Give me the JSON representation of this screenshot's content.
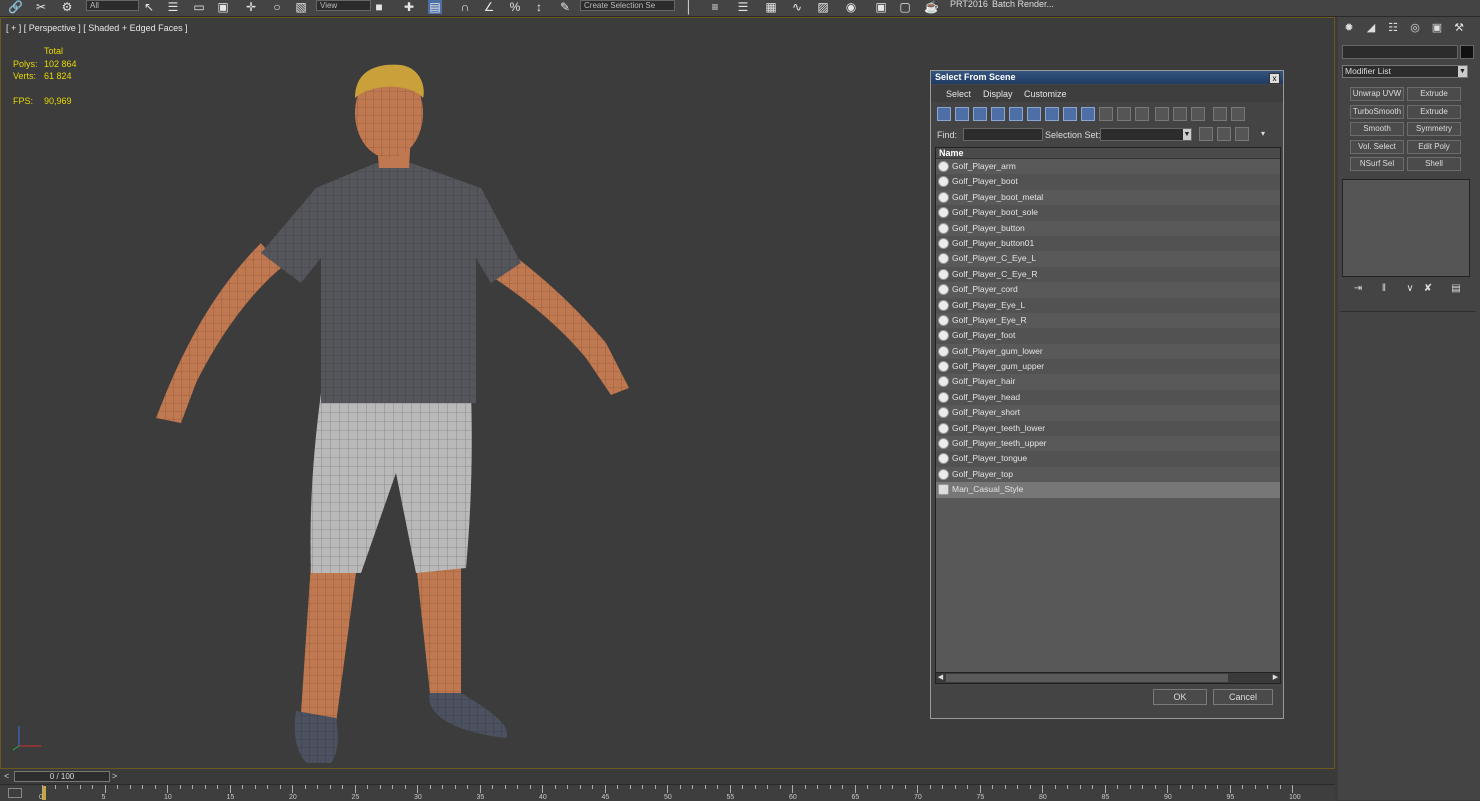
{
  "toolbar": {
    "layer_dropdown": "All",
    "ref_coord": "View",
    "selection_set_placeholder": "Create Selection Se",
    "prt_label": "PRT2016",
    "batch_render_label": "Batch Render..."
  },
  "viewport": {
    "label": "[ + ] [ Perspective ] [ Shaded + Edged Faces ]",
    "stats": {
      "total_label": "Total",
      "polys_label": "Polys:",
      "polys_value": "102 864",
      "verts_label": "Verts:",
      "verts_value": "61 824",
      "fps_label": "FPS:",
      "fps_value": "90,969"
    }
  },
  "dialog": {
    "title": "Select From Scene",
    "close": "x",
    "menu": [
      "Select",
      "Display",
      "Customize"
    ],
    "find_label": "Find:",
    "find_value": "",
    "selection_set_label": "Selection Set:",
    "list_header": "Name",
    "items": [
      "Golf_Player_arm",
      "Golf_Player_boot",
      "Golf_Player_boot_metal",
      "Golf_Player_boot_sole",
      "Golf_Player_button",
      "Golf_Player_button01",
      "Golf_Player_C_Eye_L",
      "Golf_Player_C_Eye_R",
      "Golf_Player_cord",
      "Golf_Player_Eye_L",
      "Golf_Player_Eye_R",
      "Golf_Player_foot",
      "Golf_Player_gum_lower",
      "Golf_Player_gum_upper",
      "Golf_Player_hair",
      "Golf_Player_head",
      "Golf_Player_short",
      "Golf_Player_teeth_lower",
      "Golf_Player_teeth_upper",
      "Golf_Player_tongue",
      "Golf_Player_top",
      "Man_Casual_Style"
    ],
    "ok_label": "OK",
    "cancel_label": "Cancel"
  },
  "command_panel": {
    "modifier_list": "Modifier List",
    "modifier_buttons": [
      [
        "Unwrap UVW",
        "Extrude"
      ],
      [
        "TurboSmooth",
        "Extrude"
      ],
      [
        "Smooth",
        "Symmetry"
      ],
      [
        "Vol. Select",
        "Edit Poly"
      ],
      [
        "NSurf Sel",
        "Shell"
      ]
    ]
  },
  "timeline": {
    "frame_label": "0 / 100",
    "prev_arrow": "<",
    "next_arrow": ">",
    "ticks": [
      "0",
      "5",
      "10",
      "15",
      "20",
      "25",
      "30",
      "35",
      "40",
      "45",
      "50",
      "55",
      "60",
      "65",
      "70",
      "75",
      "80",
      "85",
      "90",
      "95",
      "100"
    ]
  },
  "colors": {
    "stats_text": "#e8d900",
    "dialog_title_bar": "#1f3b63",
    "viewport_border": "#6a5a20"
  }
}
